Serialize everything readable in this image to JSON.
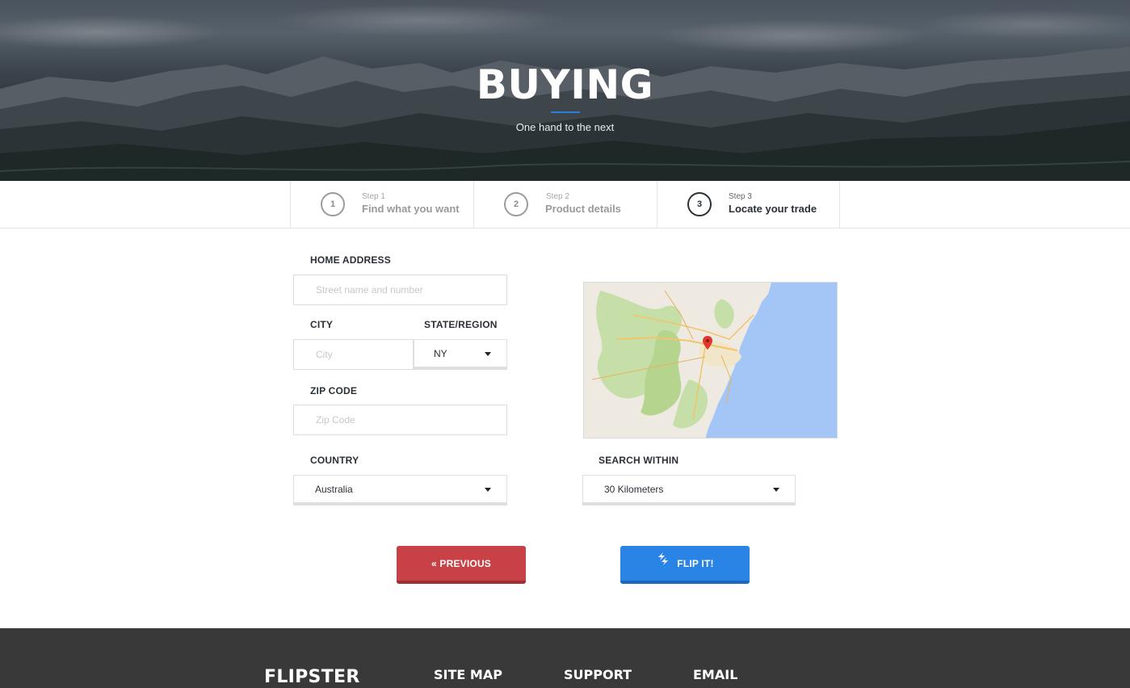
{
  "hero": {
    "title": "BUYING",
    "subtitle": "One hand to the next"
  },
  "steps": [
    {
      "number": "1",
      "small": "Step 1",
      "label": "Find what you want",
      "active": false
    },
    {
      "number": "2",
      "small": "Step 2",
      "label": "Product details",
      "active": false
    },
    {
      "number": "3",
      "small": "Step 3",
      "label": "Locate your trade",
      "active": true
    }
  ],
  "form": {
    "home_address_label": "HOME ADDRESS",
    "home_address_placeholder": "Street name and number",
    "city_label": "CITY",
    "city_placeholder": "City",
    "state_label": "STATE/REGION",
    "state_value": "NY",
    "zip_label": "ZIP CODE",
    "zip_placeholder": "Zip Code",
    "country_label": "COUNTRY",
    "country_value": "Australia",
    "search_within_label": "SEARCH WITHIN",
    "search_within_value": "30 Kilometers"
  },
  "buttons": {
    "previous_label": "« PREVIOUS",
    "flip_label": "FLIP IT!"
  },
  "footer": {
    "brand": "FLIPSTER",
    "site_map": "SITE MAP",
    "support": "SUPPORT",
    "email": "EMAIL"
  },
  "colors": {
    "accent_blue": "#2a84e6",
    "accent_red": "#c84146",
    "footer_bg": "#393939",
    "text_dark": "#2b2f36"
  },
  "icons": {
    "dropdown": "caret-down-icon",
    "flip": "flip-icon",
    "map_pin": "map-pin-icon"
  }
}
